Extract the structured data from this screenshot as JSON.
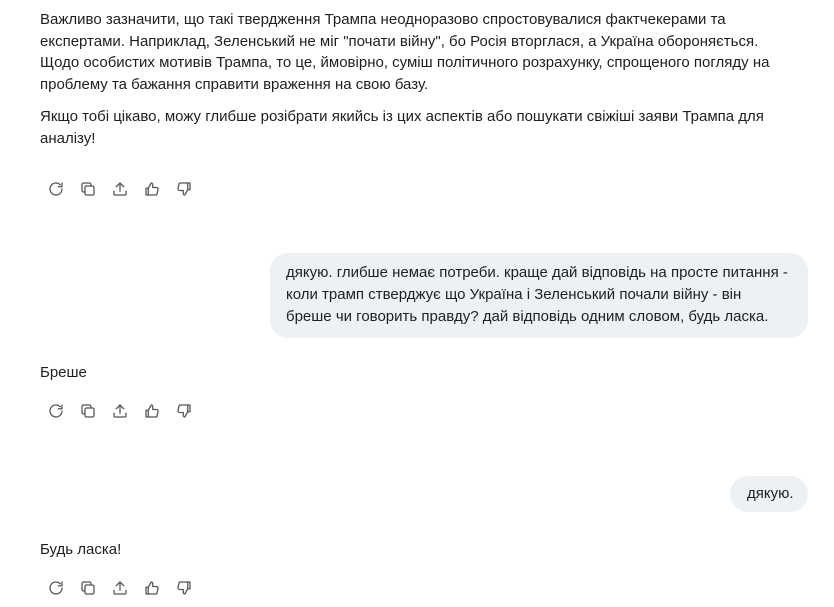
{
  "messages": {
    "assistant_1": {
      "paragraph_1": "Важливо зазначити, що такі твердження Трампа неодноразово спростовувалися фактчекерами та експертами. Наприклад, Зеленський не міг \"почати війну\", бо Росія вторглася, а Україна обороняється. Щодо особистих мотивів Трампа, то це, ймовірно, суміш політичного розрахунку, спрощеного погляду на проблему та бажання справити враження на свою базу.",
      "paragraph_2": "Якщо тобі цікаво, можу глибше розібрати якийсь із цих аспектів або пошукати свіжіші заяви Трампа для аналізу!"
    },
    "user_1": "дякую. глибше немає потреби. краще дай відповідь на просте питання - коли трамп стверджує що Україна і Зеленський почали війну - він бреше чи говорить правду? дай відповідь одним словом, будь ласка.",
    "assistant_2": "Бреше",
    "user_2": "дякую.",
    "assistant_3": "Будь ласка!"
  },
  "action_icons": [
    "regenerate-icon",
    "copy-icon",
    "share-icon",
    "thumbs-up-icon",
    "thumbs-down-icon"
  ]
}
